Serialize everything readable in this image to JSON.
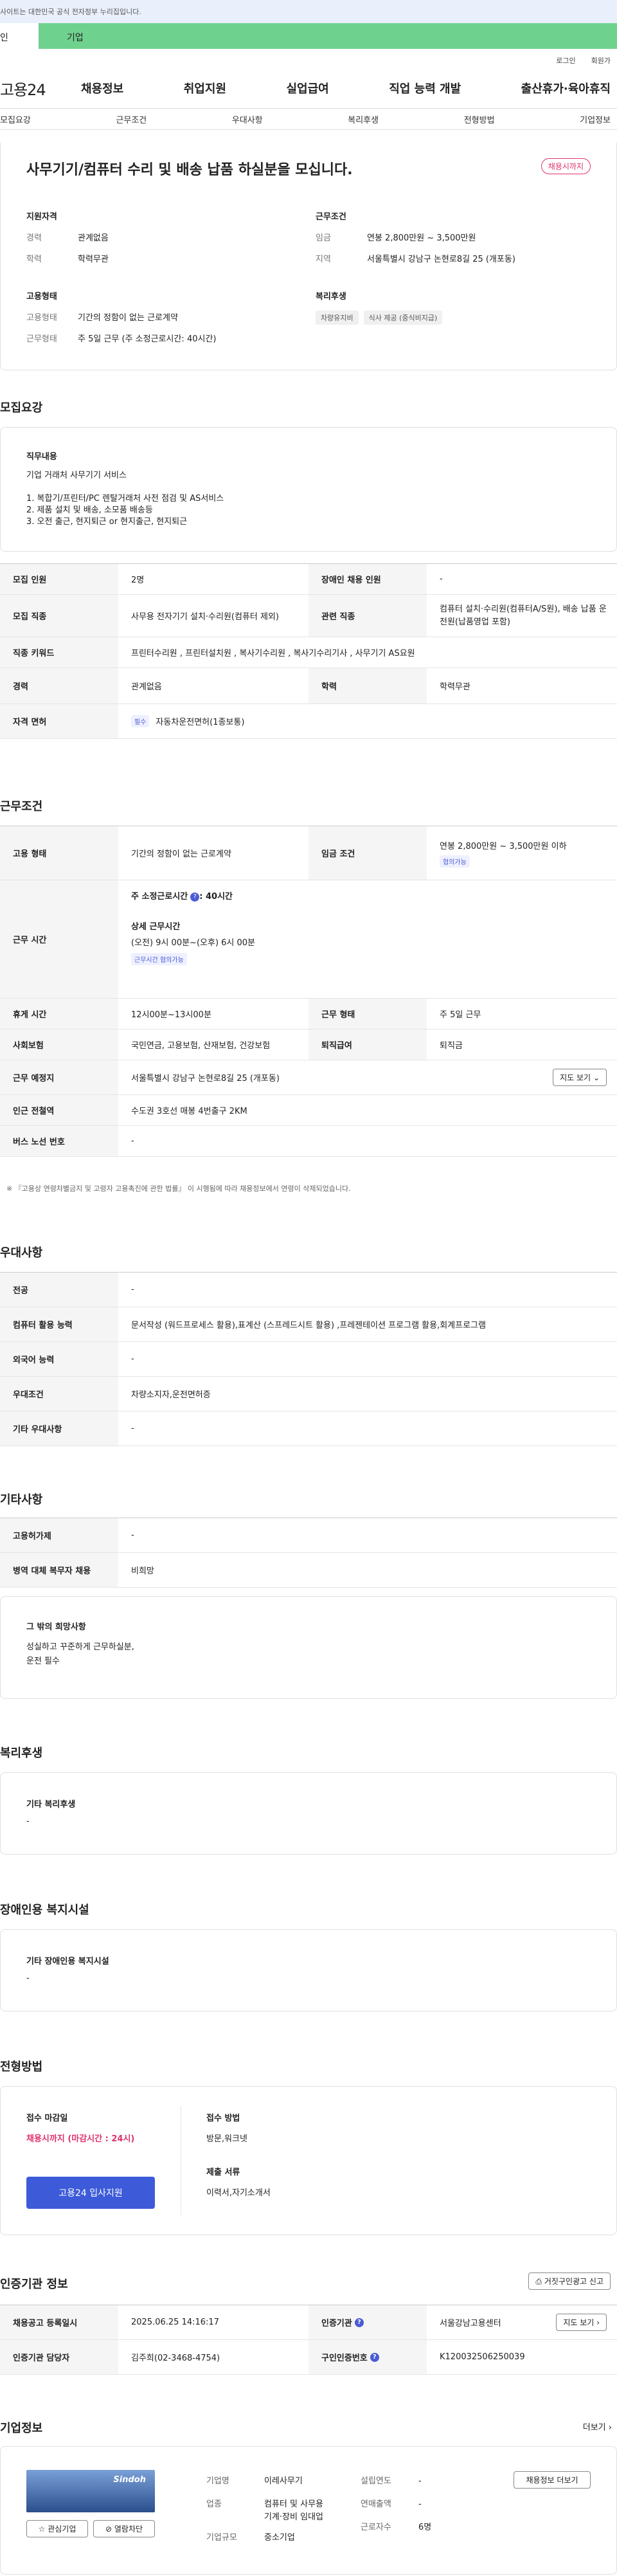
{
  "gov": {
    "notice": "사이트는 대한민국 공식 전자정부 누리집입니다."
  },
  "seg": {
    "personal": "인",
    "company": "기업"
  },
  "top_links": {
    "login": "로그인",
    "signup": "회원가"
  },
  "gnb": {
    "logo": "고용24",
    "menu": [
      "채용정보",
      "취업지원",
      "실업급여",
      "직업 능력 개발",
      "출산휴가·육아휴직"
    ]
  },
  "anchors": [
    "모집요강",
    "근무조건",
    "우대사항",
    "복리후생",
    "전형방법",
    "기업정보"
  ],
  "summary": {
    "title": "사무기기/컴퓨터 수리 및 배송 납품 하실분을 모십니다.",
    "status": "채용시까지",
    "qual_h": "지원자격",
    "career_k": "경력",
    "career_v": "관계없음",
    "edu_k": "학력",
    "edu_v": "학력무관",
    "work_h": "근무조건",
    "wage_k": "임금",
    "wage_v": "연봉 2,800만원 ~ 3,500만원",
    "region_k": "지역",
    "region_v": "서울특별시 강남구 논현로8길 25 (개포동)",
    "emp_h": "고용형태",
    "emp_k": "고용형태",
    "emp_v": "기간의 정함이 없는 근로계약",
    "shift_k": "근무형태",
    "shift_v": "주 5일 근무 (주 소정근로시간: 40시간)",
    "welfare_h": "복리후생",
    "welfare_tags": [
      "차량유지비",
      "식사 제공 (중식비지급)"
    ]
  },
  "recruit": {
    "heading": "모집요강",
    "job_h": "직무내용",
    "job_lines": [
      "기업 거래처 사무기기 서비스",
      "",
      "1. 복합기/프린터/PC 렌탈거래처 사전 점검 및 AS서비스",
      "2. 제품 설치 및 배송, 소모품 배송등",
      "3. 오전 출근, 현지퇴근 or 현지출근, 현지퇴근"
    ],
    "rows": [
      {
        "k1": "모집 인원",
        "v1": "2명",
        "k2": "장애인 채용 인원",
        "v2": "-"
      },
      {
        "k1": "모집 직종",
        "v1": "사무용 전자기기 설치·수리원(컴퓨터 제외)",
        "k2": "관련 직종",
        "v2": "컴퓨터 설치·수리원(컴퓨터A/S원), 배송 납품 운전원(납품영업 포함)"
      }
    ],
    "kw_k": "직종 키워드",
    "kw_v": "프린터수리원 , 프린터설치원 , 복사기수리원 , 복사기수리기사 , 사무기기 AS요원",
    "career_row": {
      "k1": "경력",
      "v1": "관계없음",
      "k2": "학력",
      "v2": "학력무관"
    },
    "license_k": "자격 면허",
    "license_tag": "필수",
    "license_v": "자동차운전면허(1종보통)"
  },
  "cond": {
    "heading": "근무조건",
    "emp_k": "고용 형태",
    "emp_v": "기간의 정함이 없는 근로계약",
    "wage_k": "임금 조건",
    "wage_v": "연봉 2,800만원 ~ 3,500만원 이하",
    "wage_tag": "협의가능",
    "time_k": "근무 시간",
    "time_week": "주 소정근로시간",
    "time_week_v": ": 40시간",
    "time_detail_h": "상세 근무시간",
    "time_detail": "(오전) 9시 00분~(오후) 6시 00분",
    "time_tag": "근무시간 협의가능",
    "rest_k": "휴게 시간",
    "rest_v": "12시00분~13시00분",
    "shift_k": "근무 형태",
    "shift_v": "주 5일 근무",
    "ins_k": "사회보험",
    "ins_v": "국민연금, 고용보험, 산재보험, 건강보험",
    "sev_k": "퇴직급여",
    "sev_v": "퇴직금",
    "place_k": "근무 예정지",
    "place_v": "서울특별시 강남구 논현로8길 25 (개포동)",
    "map_btn": "지도 보기",
    "station_k": "인근 전철역",
    "station_v": "수도권 3호선 매봉 4번출구 2KM",
    "bus_k": "버스 노선 번호",
    "bus_v": "-",
    "note": "※ 『고용상 연령차별금지 및 고령자 고용촉진에 관한 법률』 이 시행됨에 따라 채용정보에서 연령이 삭제되었습니다."
  },
  "pref": {
    "heading": "우대사항",
    "rows": [
      {
        "k": "전공",
        "v": "-"
      },
      {
        "k": "컴퓨터 활용 능력",
        "v": "문서작성 (워드프로세스 활용),표계산 (스프레드시트 활용) ,프레젠테이션 프로그램 활용,회계프로그램"
      },
      {
        "k": "외국어 능력",
        "v": "-"
      },
      {
        "k": "우대조건",
        "v": "차량소지자,운전면허증"
      },
      {
        "k": "기타 우대사항",
        "v": "-"
      }
    ]
  },
  "etc": {
    "heading": "기타사항",
    "rows": [
      {
        "k": "고용허가제",
        "v": "-"
      },
      {
        "k": "병역 대체 복무자 채용",
        "v": "비희망"
      }
    ],
    "hope_h": "그 밖의 희망사항",
    "hope_lines": [
      "성실하고 꾸준하게 근무하실분,",
      "운전 필수"
    ]
  },
  "welfare": {
    "heading": "복리후생",
    "box_h": "기타 복리후생",
    "box_v": "-"
  },
  "disab": {
    "heading": "장애인용 복지시설",
    "box_h": "기타 장애인용 복지시설",
    "box_v": "-"
  },
  "select": {
    "heading": "전형방법",
    "deadline_h": "접수 마감일",
    "deadline_v": "채용시까지 (마감시간 : 24시)",
    "apply_btn": "고용24 입사지원",
    "method_h": "접수 방법",
    "method_v": "방문,워크넷",
    "doc_h": "제출 서류",
    "doc_v": "이력서,자기소개서"
  },
  "cert": {
    "heading": "인증기관 정보",
    "report_btn": "거짓구인광고 신고",
    "reg_k": "채용공고 등록일시",
    "reg_v": "2025.06.25 14:16:17",
    "org_k": "인증기관",
    "org_v": "서울강남고용센터",
    "map_btn": "지도 보기",
    "mgr_k": "인증기관 담당자",
    "mgr_v": "김주희(02-3468-4754)",
    "id_k": "구인인증번호",
    "id_v": "K120032506250039"
  },
  "company": {
    "heading": "기업정보",
    "more": "더보기",
    "logo_text": "Sindoh",
    "fav_btn": "관심기업",
    "block_btn": "열람차단",
    "name_k": "기업명",
    "name_v": "이레사무기",
    "ind_k": "업종",
    "ind_v1": "컴퓨터 및 사무용",
    "ind_v2": "기계·장비 임대업",
    "size_k": "기업규모",
    "size_v": "중소기업",
    "year_k": "설립연도",
    "year_v": "-",
    "sales_k": "연매출액",
    "sales_v": "-",
    "emp_k": "근로자수",
    "emp_v": "6명",
    "more_btn": "채용정보 더보기"
  },
  "colors": {
    "accent": "#3d5bd9",
    "status_red": "#e0336b",
    "green_tab": "#6fd18e"
  }
}
